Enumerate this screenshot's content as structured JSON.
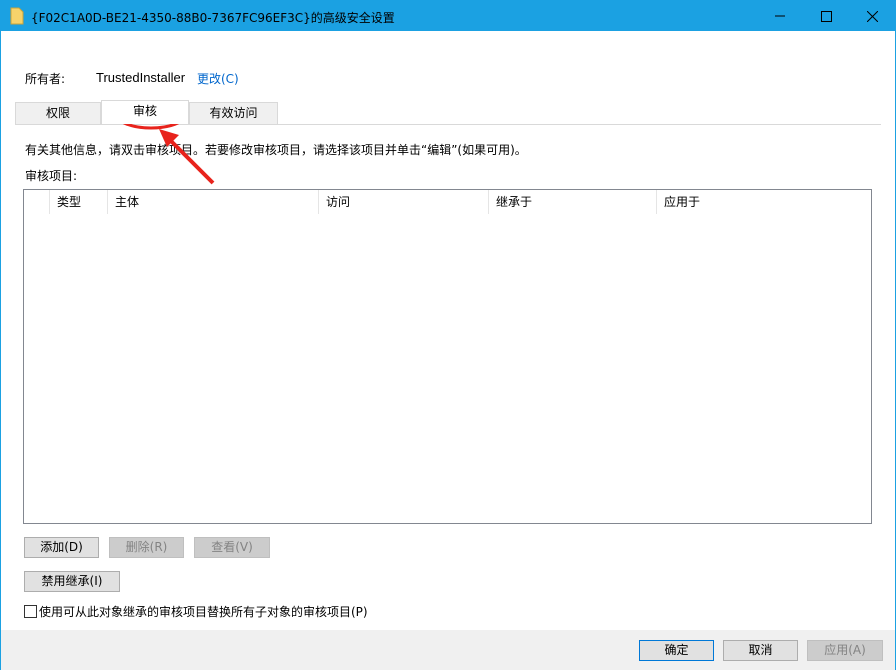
{
  "window": {
    "title": "{F02C1A0D-BE21-4350-88B0-7367FC96EF3C}的高级安全设置",
    "accent": "#1ba1e2"
  },
  "owner": {
    "label": "所有者:",
    "value": "TrustedInstaller",
    "change_link": "更改(C)"
  },
  "tabs": [
    {
      "label": "权限",
      "active": false
    },
    {
      "label": "审核",
      "active": true
    },
    {
      "label": "有效访问",
      "active": false
    }
  ],
  "info_text": "有关其他信息，请双击审核项目。若要修改审核项目，请选择该项目并单击“编辑”(如果可用)。",
  "list": {
    "label": "审核项目:",
    "columns": [
      "类型",
      "主体",
      "访问",
      "继承于",
      "应用于"
    ],
    "rows": []
  },
  "buttons": {
    "add": "添加(D)",
    "remove": "删除(R)",
    "view": "查看(V)",
    "disable_inheritance": "禁用继承(I)",
    "ok": "确定",
    "cancel": "取消",
    "apply": "应用(A)"
  },
  "replace_checkbox": {
    "label": "使用可从此对象继承的审核项目替换所有子对象的审核项目(P)",
    "checked": false
  },
  "annotation": {
    "color": "#e8231c"
  }
}
